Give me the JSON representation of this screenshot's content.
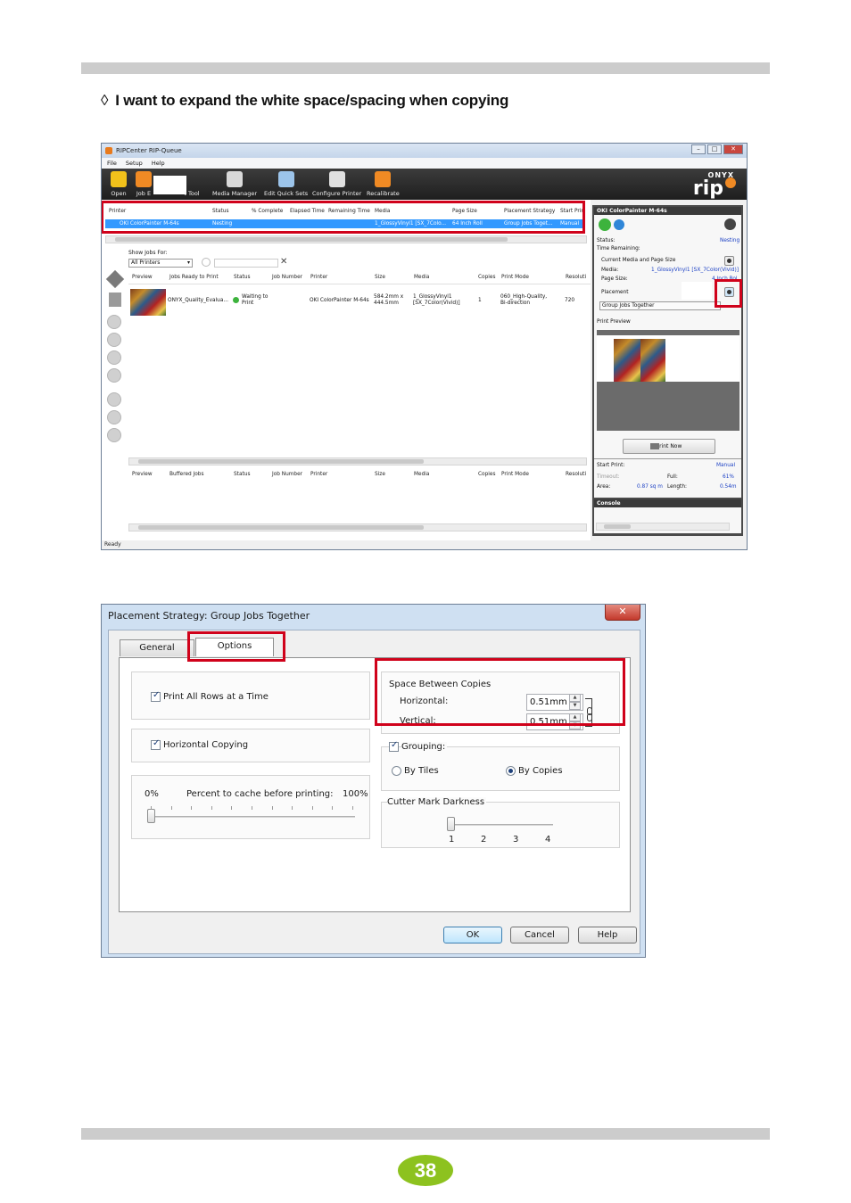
{
  "heading": {
    "bullet": "◊",
    "text": "I want to expand the white space/spacing when copying"
  },
  "screenshot1": {
    "title": "RIPCenter RIP-Queue",
    "window_controls": [
      "–",
      "□",
      "✕"
    ],
    "menu": [
      "File",
      "Setup",
      "Help"
    ],
    "toolbar": [
      "Open",
      "Job E",
      "t Tool",
      "Media Manager",
      "Edit Quick Sets",
      "Configure Printer",
      "Recalibrate"
    ],
    "logo": {
      "top": "ONYX",
      "main": "rip"
    },
    "printer_table": {
      "headers": [
        "Printer",
        "Status",
        "% Complete",
        "Elapsed Time",
        "Remaining Time",
        "Media",
        "Page Size",
        "Placement Strategy",
        "Start Prin"
      ],
      "row": [
        "OKI ColorPainter M-64s",
        "Nesting",
        "1_GlossyVinyl1 [SX_7Colo...",
        "64 Inch Roll",
        "Group Jobs Toget...",
        "Manual"
      ]
    },
    "show_jobs_for": {
      "label": "Show Jobs For:",
      "value": "All Printers"
    },
    "jobs_table": {
      "headers": [
        "Preview",
        "Jobs Ready to Print",
        "Status",
        "Job Number",
        "Printer",
        "Size",
        "Media",
        "Copies",
        "Print Mode",
        "Resoluti"
      ],
      "row": {
        "name": "ONYX_Quality_Evalua...",
        "status": [
          "Waiting to",
          "Print"
        ],
        "printer": "OKI ColorPainter M-64s",
        "size": [
          "584.2mm x",
          "444.5mm"
        ],
        "media": [
          "1_GlossyVinyl1",
          "[SX_7Color(Vivid)]"
        ],
        "copies": "1",
        "print_mode": [
          "060_High-Quality,",
          "Bi-direction"
        ],
        "resolution": "720"
      }
    },
    "buffered_table": {
      "headers": [
        "Preview",
        "Buffered Jobs",
        "Status",
        "Job Number",
        "Printer",
        "Size",
        "Media",
        "Copies",
        "Print Mode",
        "Resoluti"
      ]
    },
    "right_panel": {
      "title": "OKI ColorPainter M-64s",
      "status_label": "Status:",
      "status_value": "Nesting",
      "time_remaining_label": "Time Remaining:",
      "current_media_label": "Current Media and Page Size",
      "media_label": "Media:",
      "media_value": "1_GlossyVinyl1 [SX_7Color(Vivid)]",
      "page_size_label": "Page Size:",
      "page_size_value": "4 Inch Rol",
      "placement_label": "Placement",
      "placement_value": "Group Jobs Together",
      "print_preview_label": "Print Preview",
      "print_now": "Print Now",
      "start_print_label": "Start Print:",
      "start_print_value": "Manual",
      "timeout_label": "Timeout:",
      "full_label": "Full:",
      "full_value": "61%",
      "area_label": "Area:",
      "area_value": "0.87 sq m",
      "length_label": "Length:",
      "length_value": "0.54m",
      "console_title": "Console"
    },
    "status_bar": "Ready"
  },
  "screenshot2": {
    "title": "Placement Strategy: Group Jobs Together",
    "close": "✕",
    "tabs": [
      "General",
      "Options"
    ],
    "print_all_rows": "Print All Rows at a Time",
    "horizontal_copying": "Horizontal Copying",
    "cache": {
      "min": "0%",
      "label": "Percent to cache before printing:",
      "max": "100%",
      "level": 0
    },
    "space_between_copies": {
      "title": "Space Between Copies",
      "horizontal_label": "Horizontal:",
      "horizontal_value": "0.51mm",
      "vertical_label": "Vertical:",
      "vertical_value": "0.51mm"
    },
    "grouping": {
      "label": "Grouping:",
      "options": [
        "By Tiles",
        "By Copies"
      ],
      "selected": "By Copies"
    },
    "cutter_mark": {
      "label": "Cutter Mark Darkness",
      "ticks": [
        "1",
        "2",
        "3",
        "4"
      ],
      "level": 1
    },
    "buttons": [
      "OK",
      "Cancel",
      "Help"
    ]
  },
  "page_number": "38",
  "colors": {
    "highlight_red": "#d0021b",
    "badge_green": "#8dc21f",
    "selection_blue": "#3399ff",
    "rule_grey": "#cccccc"
  }
}
